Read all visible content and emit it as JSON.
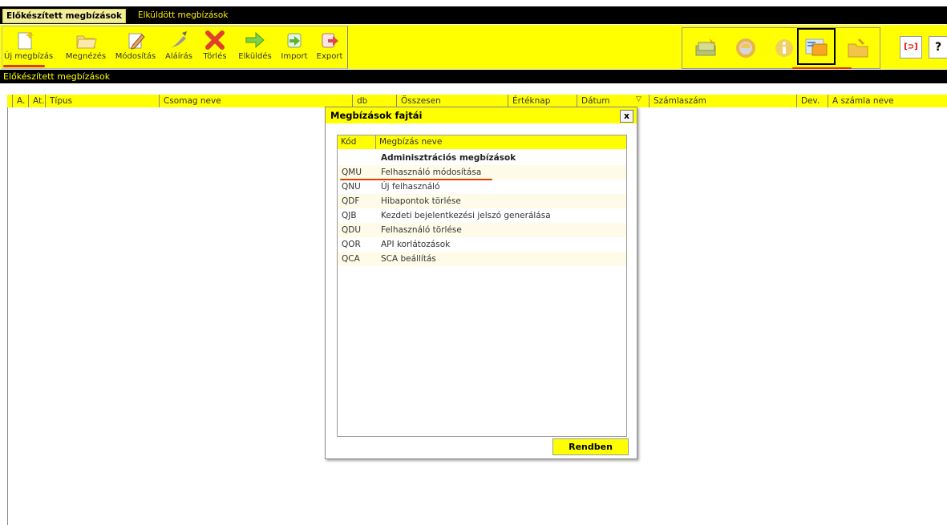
{
  "tabs": [
    {
      "label": "Előkészített megbízások"
    },
    {
      "label": "Elküldött megbízások"
    }
  ],
  "toolbar": {
    "buttons": [
      {
        "label": "Új megbízás",
        "icon": "new-document-icon"
      },
      {
        "label": "Megnézés",
        "icon": "folder-icon"
      },
      {
        "label": "Módosítás",
        "icon": "edit-pencil-icon"
      },
      {
        "label": "Aláírás",
        "icon": "sign-pen-icon"
      },
      {
        "label": "Törlés",
        "icon": "delete-x-icon"
      },
      {
        "label": "Elküldés",
        "icon": "send-arrow-icon"
      },
      {
        "label": "Import",
        "icon": "import-icon"
      },
      {
        "label": "Export",
        "icon": "export-icon"
      }
    ],
    "right_icons": [
      "money-icon",
      "globe-icon",
      "info-icon",
      "transfer-folder-icon",
      "settings-folder-icon"
    ],
    "small_buttons": [
      "ic-card-icon",
      "?"
    ]
  },
  "section_title": "Előkészített megbízások",
  "grid_columns": [
    "A.",
    "At.",
    "Típus",
    "Csomag neve",
    "db",
    "Összesen",
    "Értéknap",
    "Dátum",
    "Számlaszám",
    "Dev.",
    "A számla neve"
  ],
  "dialog": {
    "title": "Megbízások fajtái",
    "close_label": "x",
    "columns": [
      "Kód",
      "Megbízás neve"
    ],
    "group_label": "Adminisztrációs megbízások",
    "rows": [
      {
        "code": "QMU",
        "name": "Felhasználó módosítása"
      },
      {
        "code": "QNU",
        "name": "Új felhasználó"
      },
      {
        "code": "QDF",
        "name": "Hibapontok törlése"
      },
      {
        "code": "QJB",
        "name": "Kezdeti bejelentkezési jelszó generálása"
      },
      {
        "code": "QDU",
        "name": "Felhasználó törlése"
      },
      {
        "code": "QOR",
        "name": "API korlátozások"
      },
      {
        "code": "QCA",
        "name": "SCA beállítás"
      }
    ],
    "ok_label": "Rendben"
  },
  "colors": {
    "yellow": "#ffff00",
    "black": "#000000",
    "highlight_red": "#e03c00"
  }
}
